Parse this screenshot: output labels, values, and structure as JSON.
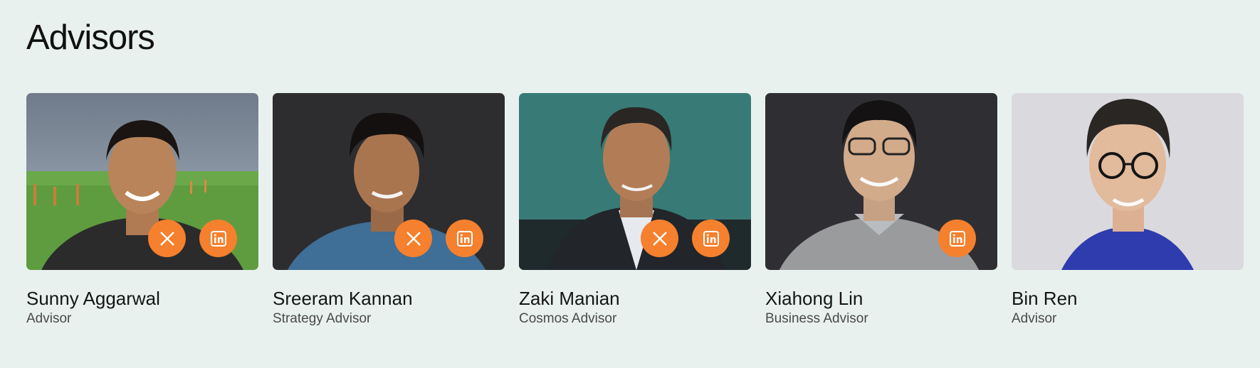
{
  "section": {
    "title": "Advisors"
  },
  "colors": {
    "background": "#e8f1ee",
    "accent": "#f5802e"
  },
  "advisors": [
    {
      "name": "Sunny Aggarwal",
      "role": "Advisor",
      "socials": [
        "x-icon",
        "linkedin-icon"
      ]
    },
    {
      "name": "Sreeram Kannan",
      "role": "Strategy Advisor",
      "socials": [
        "x-icon",
        "linkedin-icon"
      ]
    },
    {
      "name": "Zaki Manian",
      "role": "Cosmos Advisor",
      "socials": [
        "x-icon",
        "linkedin-icon"
      ]
    },
    {
      "name": "Xiahong Lin",
      "role": "Business Advisor",
      "socials": [
        "linkedin-icon"
      ]
    },
    {
      "name": "Bin Ren",
      "role": "Advisor",
      "socials": []
    }
  ]
}
